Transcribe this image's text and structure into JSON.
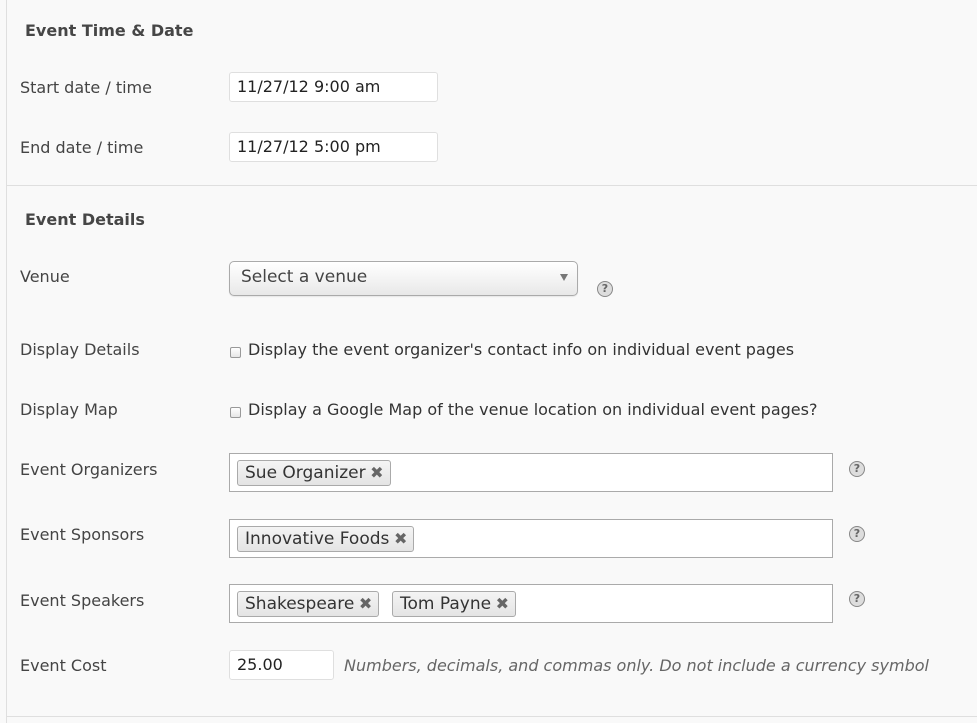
{
  "time_section": {
    "title": "Event Time & Date",
    "start": {
      "label": "Start date / time",
      "value": "11/27/12 9:00 am"
    },
    "end": {
      "label": "End date / time",
      "value": "11/27/12 5:00 pm"
    }
  },
  "details_section": {
    "title": "Event Details",
    "venue": {
      "label": "Venue",
      "selected": "Select a venue",
      "help": "?"
    },
    "display_details": {
      "label": "Display Details",
      "checked": false,
      "text": "Display the event organizer's contact info on individual event pages"
    },
    "display_map": {
      "label": "Display Map",
      "checked": false,
      "text": "Display a Google Map of the venue location on individual event pages?"
    },
    "organizers": {
      "label": "Event Organizers",
      "chips": [
        "Sue Organizer"
      ],
      "help": "?"
    },
    "sponsors": {
      "label": "Event Sponsors",
      "chips": [
        "Innovative Foods"
      ],
      "help": "?"
    },
    "speakers": {
      "label": "Event Speakers",
      "chips": [
        "Shakespeare",
        "Tom Payne"
      ],
      "help": "?"
    },
    "cost": {
      "label": "Event Cost",
      "value": "25.00",
      "hint": "Numbers, decimals, and commas only. Do not include a currency symbol"
    }
  },
  "remove_glyph": "✖"
}
